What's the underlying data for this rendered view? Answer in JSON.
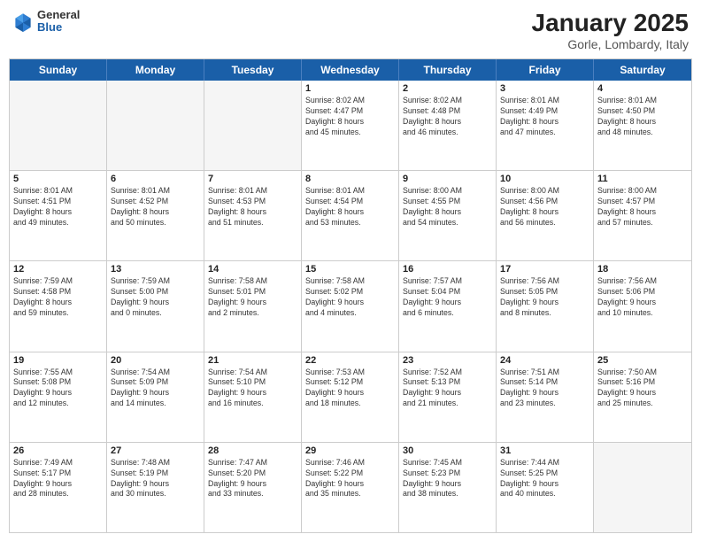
{
  "header": {
    "logo": {
      "general": "General",
      "blue": "Blue"
    },
    "title": "January 2025",
    "location": "Gorle, Lombardy, Italy"
  },
  "weekdays": [
    "Sunday",
    "Monday",
    "Tuesday",
    "Wednesday",
    "Thursday",
    "Friday",
    "Saturday"
  ],
  "weeks": [
    [
      {
        "day": "",
        "info": "",
        "empty": true
      },
      {
        "day": "",
        "info": "",
        "empty": true
      },
      {
        "day": "",
        "info": "",
        "empty": true
      },
      {
        "day": "1",
        "info": "Sunrise: 8:02 AM\nSunset: 4:47 PM\nDaylight: 8 hours\nand 45 minutes."
      },
      {
        "day": "2",
        "info": "Sunrise: 8:02 AM\nSunset: 4:48 PM\nDaylight: 8 hours\nand 46 minutes."
      },
      {
        "day": "3",
        "info": "Sunrise: 8:01 AM\nSunset: 4:49 PM\nDaylight: 8 hours\nand 47 minutes."
      },
      {
        "day": "4",
        "info": "Sunrise: 8:01 AM\nSunset: 4:50 PM\nDaylight: 8 hours\nand 48 minutes."
      }
    ],
    [
      {
        "day": "5",
        "info": "Sunrise: 8:01 AM\nSunset: 4:51 PM\nDaylight: 8 hours\nand 49 minutes."
      },
      {
        "day": "6",
        "info": "Sunrise: 8:01 AM\nSunset: 4:52 PM\nDaylight: 8 hours\nand 50 minutes."
      },
      {
        "day": "7",
        "info": "Sunrise: 8:01 AM\nSunset: 4:53 PM\nDaylight: 8 hours\nand 51 minutes."
      },
      {
        "day": "8",
        "info": "Sunrise: 8:01 AM\nSunset: 4:54 PM\nDaylight: 8 hours\nand 53 minutes."
      },
      {
        "day": "9",
        "info": "Sunrise: 8:00 AM\nSunset: 4:55 PM\nDaylight: 8 hours\nand 54 minutes."
      },
      {
        "day": "10",
        "info": "Sunrise: 8:00 AM\nSunset: 4:56 PM\nDaylight: 8 hours\nand 56 minutes."
      },
      {
        "day": "11",
        "info": "Sunrise: 8:00 AM\nSunset: 4:57 PM\nDaylight: 8 hours\nand 57 minutes."
      }
    ],
    [
      {
        "day": "12",
        "info": "Sunrise: 7:59 AM\nSunset: 4:58 PM\nDaylight: 8 hours\nand 59 minutes."
      },
      {
        "day": "13",
        "info": "Sunrise: 7:59 AM\nSunset: 5:00 PM\nDaylight: 9 hours\nand 0 minutes."
      },
      {
        "day": "14",
        "info": "Sunrise: 7:58 AM\nSunset: 5:01 PM\nDaylight: 9 hours\nand 2 minutes."
      },
      {
        "day": "15",
        "info": "Sunrise: 7:58 AM\nSunset: 5:02 PM\nDaylight: 9 hours\nand 4 minutes."
      },
      {
        "day": "16",
        "info": "Sunrise: 7:57 AM\nSunset: 5:04 PM\nDaylight: 9 hours\nand 6 minutes."
      },
      {
        "day": "17",
        "info": "Sunrise: 7:56 AM\nSunset: 5:05 PM\nDaylight: 9 hours\nand 8 minutes."
      },
      {
        "day": "18",
        "info": "Sunrise: 7:56 AM\nSunset: 5:06 PM\nDaylight: 9 hours\nand 10 minutes."
      }
    ],
    [
      {
        "day": "19",
        "info": "Sunrise: 7:55 AM\nSunset: 5:08 PM\nDaylight: 9 hours\nand 12 minutes."
      },
      {
        "day": "20",
        "info": "Sunrise: 7:54 AM\nSunset: 5:09 PM\nDaylight: 9 hours\nand 14 minutes."
      },
      {
        "day": "21",
        "info": "Sunrise: 7:54 AM\nSunset: 5:10 PM\nDaylight: 9 hours\nand 16 minutes."
      },
      {
        "day": "22",
        "info": "Sunrise: 7:53 AM\nSunset: 5:12 PM\nDaylight: 9 hours\nand 18 minutes."
      },
      {
        "day": "23",
        "info": "Sunrise: 7:52 AM\nSunset: 5:13 PM\nDaylight: 9 hours\nand 21 minutes."
      },
      {
        "day": "24",
        "info": "Sunrise: 7:51 AM\nSunset: 5:14 PM\nDaylight: 9 hours\nand 23 minutes."
      },
      {
        "day": "25",
        "info": "Sunrise: 7:50 AM\nSunset: 5:16 PM\nDaylight: 9 hours\nand 25 minutes."
      }
    ],
    [
      {
        "day": "26",
        "info": "Sunrise: 7:49 AM\nSunset: 5:17 PM\nDaylight: 9 hours\nand 28 minutes."
      },
      {
        "day": "27",
        "info": "Sunrise: 7:48 AM\nSunset: 5:19 PM\nDaylight: 9 hours\nand 30 minutes."
      },
      {
        "day": "28",
        "info": "Sunrise: 7:47 AM\nSunset: 5:20 PM\nDaylight: 9 hours\nand 33 minutes."
      },
      {
        "day": "29",
        "info": "Sunrise: 7:46 AM\nSunset: 5:22 PM\nDaylight: 9 hours\nand 35 minutes."
      },
      {
        "day": "30",
        "info": "Sunrise: 7:45 AM\nSunset: 5:23 PM\nDaylight: 9 hours\nand 38 minutes."
      },
      {
        "day": "31",
        "info": "Sunrise: 7:44 AM\nSunset: 5:25 PM\nDaylight: 9 hours\nand 40 minutes."
      },
      {
        "day": "",
        "info": "",
        "empty": true
      }
    ]
  ]
}
